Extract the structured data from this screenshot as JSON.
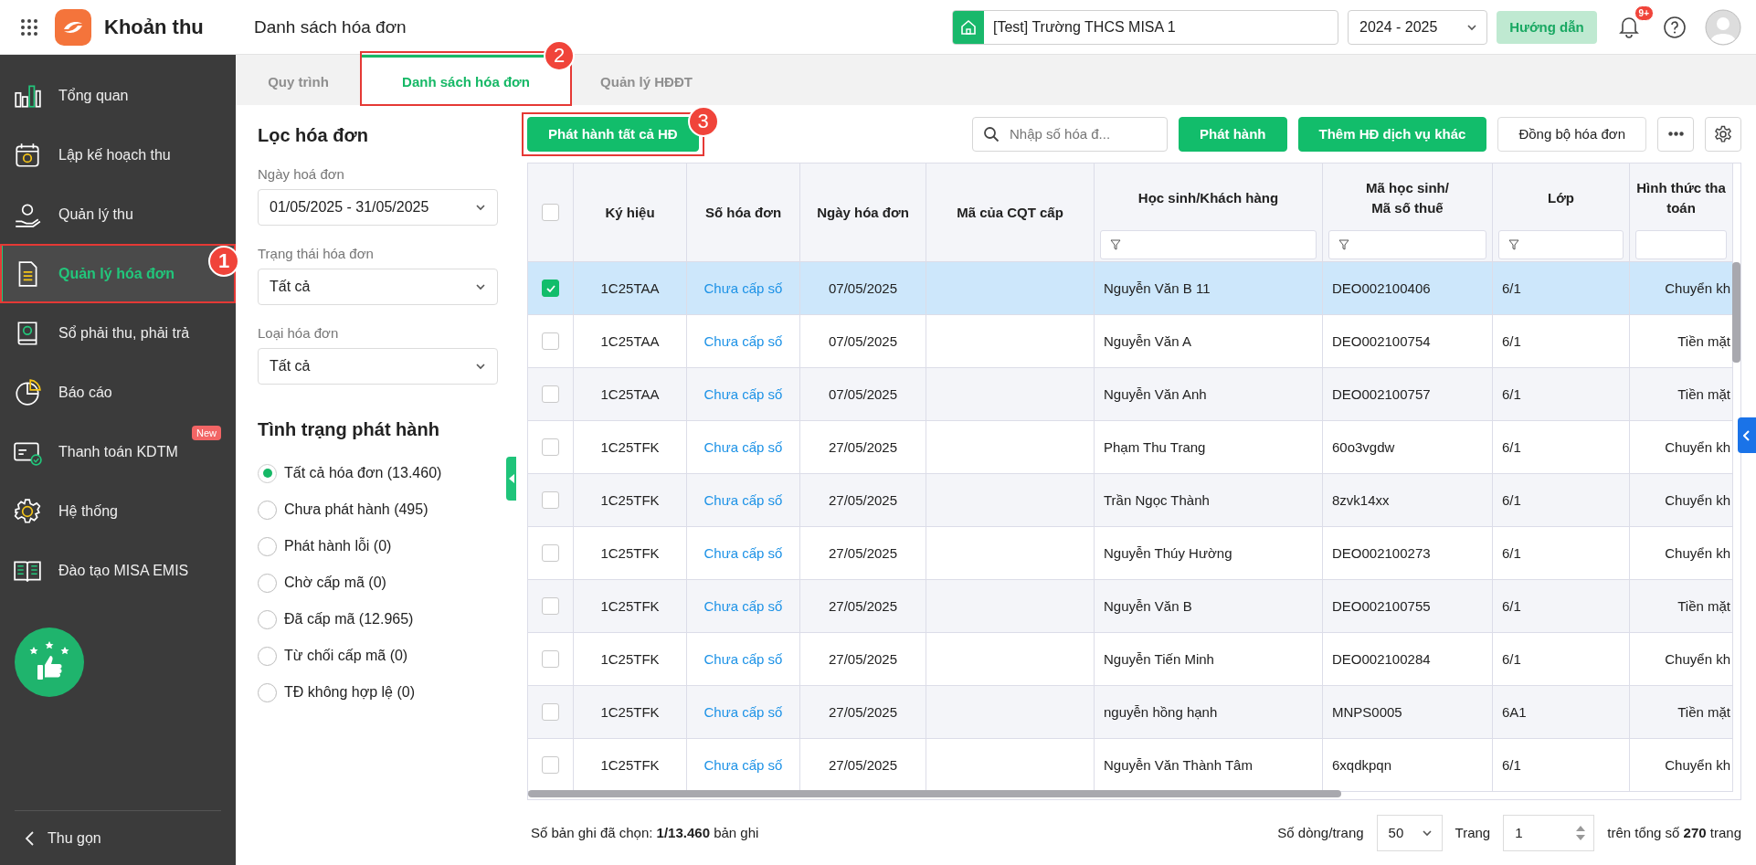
{
  "app": {
    "name": "Khoản thu"
  },
  "page_title": "Danh sách hóa đơn",
  "header": {
    "school": "[Test] Trường THCS MISA 1",
    "year": "2024 - 2025",
    "guide_button": "Hướng dẫn",
    "notification_badge": "9+"
  },
  "sidebar": {
    "items": [
      {
        "label": "Tổng quan",
        "selected": false
      },
      {
        "label": "Lập kế hoạch thu",
        "selected": false
      },
      {
        "label": "Quản lý thu",
        "selected": false
      },
      {
        "label": "Quản lý hóa đơn",
        "selected": true,
        "callout": "1"
      },
      {
        "label": "Sổ phải thu, phải trả",
        "selected": false
      },
      {
        "label": "Báo cáo",
        "selected": false
      },
      {
        "label": "Thanh toán KDTM",
        "selected": false,
        "badge": "New"
      },
      {
        "label": "Hệ thống",
        "selected": false
      },
      {
        "label": "Đào tạo MISA EMIS",
        "selected": false
      }
    ],
    "collapse": "Thu gọn"
  },
  "tabs": [
    {
      "label": "Quy trình",
      "selected": false
    },
    {
      "label": "Danh sách hóa đơn",
      "selected": true,
      "callout": "2"
    },
    {
      "label": "Quản lý HĐĐT",
      "selected": false
    }
  ],
  "filter": {
    "title": "Lọc hóa đơn",
    "fields": [
      {
        "label": "Ngày hoá đơn",
        "value": "01/05/2025 - 31/05/2025"
      },
      {
        "label": "Trạng thái hóa đơn",
        "value": "Tất cả"
      },
      {
        "label": "Loại hóa đơn",
        "value": "Tất cả"
      }
    ],
    "status_title": "Tình trạng phát hành",
    "statuses": [
      {
        "label": "Tất cả hóa đơn (13.460)",
        "selected": true
      },
      {
        "label": "Chưa phát hành (495)",
        "selected": false
      },
      {
        "label": "Phát hành lỗi (0)",
        "selected": false
      },
      {
        "label": "Chờ cấp mã (0)",
        "selected": false
      },
      {
        "label": "Đã cấp mã (12.965)",
        "selected": false
      },
      {
        "label": "Từ chối cấp mã (0)",
        "selected": false
      },
      {
        "label": "TĐ không hợp lệ (0)",
        "selected": false
      }
    ]
  },
  "toolbar": {
    "publish_all": {
      "label": "Phát hành tất cả HĐ",
      "callout": "3"
    },
    "search": {
      "placeholder": "Nhập số hóa đ..."
    },
    "buttons": [
      {
        "label": "Phát hành",
        "kind": "primary"
      },
      {
        "label": "Thêm HĐ dịch vụ khác",
        "kind": "primary"
      },
      {
        "label": "Đồng bộ hóa đơn",
        "kind": "outline"
      }
    ]
  },
  "table": {
    "select_all": {
      "checked": false
    },
    "columns": [
      {
        "label": "Ký hiệu",
        "filter": false
      },
      {
        "label": "Số hóa đơn",
        "filter": false
      },
      {
        "label": "Ngày hóa đơn",
        "filter": false
      },
      {
        "label": "Mã của CQT cấp",
        "filter": false
      },
      {
        "label": "Học sinh/Khách hàng",
        "filter": true,
        "filter_icon": true
      },
      {
        "label": "Mã học sinh/\nMã số thuế",
        "filter": true,
        "filter_icon": true
      },
      {
        "label": "Lớp",
        "filter": true,
        "filter_icon": true
      },
      {
        "label": "Hình thức tha\ntoán",
        "filter": true,
        "filter_icon": false
      }
    ],
    "rows": [
      {
        "checked": true,
        "selected": true,
        "symbol": "1C25TAA",
        "number": "Chưa cấp số",
        "date": "07/05/2025",
        "customer": "Nguyễn Văn B 11",
        "code": "DEO002100406",
        "class": "6/1",
        "payment": "Chuyển kh"
      },
      {
        "checked": false,
        "selected": false,
        "symbol": "1C25TAA",
        "number": "Chưa cấp số",
        "date": "07/05/2025",
        "customer": "Nguyễn Văn A",
        "code": "DEO002100754",
        "class": "6/1",
        "payment": "Tiền mặt"
      },
      {
        "checked": false,
        "selected": false,
        "symbol": "1C25TAA",
        "number": "Chưa cấp số",
        "date": "07/05/2025",
        "customer": "Nguyễn Văn Anh",
        "code": "DEO002100757",
        "class": "6/1",
        "payment": "Tiền mặt"
      },
      {
        "checked": false,
        "selected": false,
        "symbol": "1C25TFK",
        "number": "Chưa cấp số",
        "date": "27/05/2025",
        "customer": "Phạm Thu Trang",
        "code": "60o3vgdw",
        "class": "6/1",
        "payment": "Chuyển kh"
      },
      {
        "checked": false,
        "selected": false,
        "symbol": "1C25TFK",
        "number": "Chưa cấp số",
        "date": "27/05/2025",
        "customer": "Trần Ngọc Thành",
        "code": "8zvk14xx",
        "class": "6/1",
        "payment": "Chuyển kh"
      },
      {
        "checked": false,
        "selected": false,
        "symbol": "1C25TFK",
        "number": "Chưa cấp số",
        "date": "27/05/2025",
        "customer": "Nguyễn Thúy Hường",
        "code": "DEO002100273",
        "class": "6/1",
        "payment": "Chuyển kh"
      },
      {
        "checked": false,
        "selected": false,
        "symbol": "1C25TFK",
        "number": "Chưa cấp số",
        "date": "27/05/2025",
        "customer": "Nguyễn Văn B",
        "code": "DEO002100755",
        "class": "6/1",
        "payment": "Tiền mặt"
      },
      {
        "checked": false,
        "selected": false,
        "symbol": "1C25TFK",
        "number": "Chưa cấp số",
        "date": "27/05/2025",
        "customer": "Nguyễn Tiến Minh",
        "code": "DEO002100284",
        "class": "6/1",
        "payment": "Chuyển kh"
      },
      {
        "checked": false,
        "selected": false,
        "symbol": "1C25TFK",
        "number": "Chưa cấp số",
        "date": "27/05/2025",
        "customer": "nguyễn hồng hạnh",
        "code": "MNPS0005",
        "class": "6A1",
        "payment": "Tiền mặt"
      },
      {
        "checked": false,
        "selected": false,
        "symbol": "1C25TFK",
        "number": "Chưa cấp số",
        "date": "27/05/2025",
        "customer": "Nguyễn Văn Thành Tâm",
        "code": "6xqdkpqn",
        "class": "6/1",
        "payment": "Chuyển kh"
      }
    ]
  },
  "footer": {
    "selected_text": "Số bản ghi đã chọn: **1/13.460** bản ghi",
    "page_size_label": "Số dòng/trang",
    "page_size": "50",
    "page_label": "Trang",
    "page": "1",
    "total_text": "trên tổng số **270** trang"
  }
}
